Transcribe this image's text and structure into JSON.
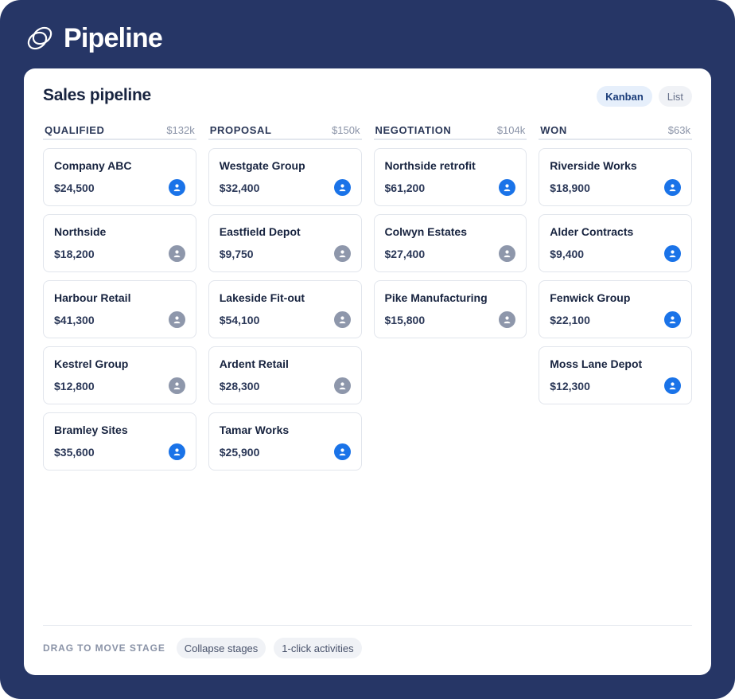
{
  "app": {
    "name": "Pipeline"
  },
  "page": {
    "title": "Sales pipeline"
  },
  "views": [
    {
      "label": "Kanban",
      "active": true
    },
    {
      "label": "List",
      "active": false
    }
  ],
  "colors": {
    "frame": "#263666",
    "owner_assigned": "#1a73e8",
    "owner_unassigned": "#8e97ab"
  },
  "columns": [
    {
      "name": "QUALIFIED",
      "total": "$132k",
      "deals": [
        {
          "name": "Company ABC",
          "value": "$24,500",
          "owner": "assigned"
        },
        {
          "name": "Northside",
          "value": "$18,200",
          "owner": "unassigned"
        },
        {
          "name": "Harbour Retail",
          "value": "$41,300",
          "owner": "unassigned"
        },
        {
          "name": "Kestrel Group",
          "value": "$12,800",
          "owner": "unassigned"
        },
        {
          "name": "Bramley Sites",
          "value": "$35,600",
          "owner": "assigned"
        }
      ]
    },
    {
      "name": "PROPOSAL",
      "total": "$150k",
      "deals": [
        {
          "name": "Westgate Group",
          "value": "$32,400",
          "owner": "assigned"
        },
        {
          "name": "Eastfield Depot",
          "value": "$9,750",
          "owner": "unassigned"
        },
        {
          "name": "Lakeside Fit-out",
          "value": "$54,100",
          "owner": "unassigned"
        },
        {
          "name": "Ardent Retail",
          "value": "$28,300",
          "owner": "unassigned"
        },
        {
          "name": "Tamar Works",
          "value": "$25,900",
          "owner": "assigned"
        }
      ]
    },
    {
      "name": "NEGOTIATION",
      "total": "$104k",
      "deals": [
        {
          "name": "Northside retrofit",
          "value": "$61,200",
          "owner": "assigned"
        },
        {
          "name": "Colwyn Estates",
          "value": "$27,400",
          "owner": "unassigned"
        },
        {
          "name": "Pike Manufacturing",
          "value": "$15,800",
          "owner": "unassigned"
        }
      ]
    },
    {
      "name": "WON",
      "total": "$63k",
      "deals": [
        {
          "name": "Riverside Works",
          "value": "$18,900",
          "owner": "assigned"
        },
        {
          "name": "Alder Contracts",
          "value": "$9,400",
          "owner": "assigned"
        },
        {
          "name": "Fenwick Group",
          "value": "$22,100",
          "owner": "assigned"
        },
        {
          "name": "Moss Lane Depot",
          "value": "$12,300",
          "owner": "assigned"
        }
      ]
    }
  ],
  "footer": {
    "hint": "DRAG TO MOVE STAGE",
    "actions": [
      "Collapse stages",
      "1-click activities"
    ]
  },
  "icons": {
    "brand": "pipeline-logo-icon",
    "owner": "user-avatar-icon"
  }
}
